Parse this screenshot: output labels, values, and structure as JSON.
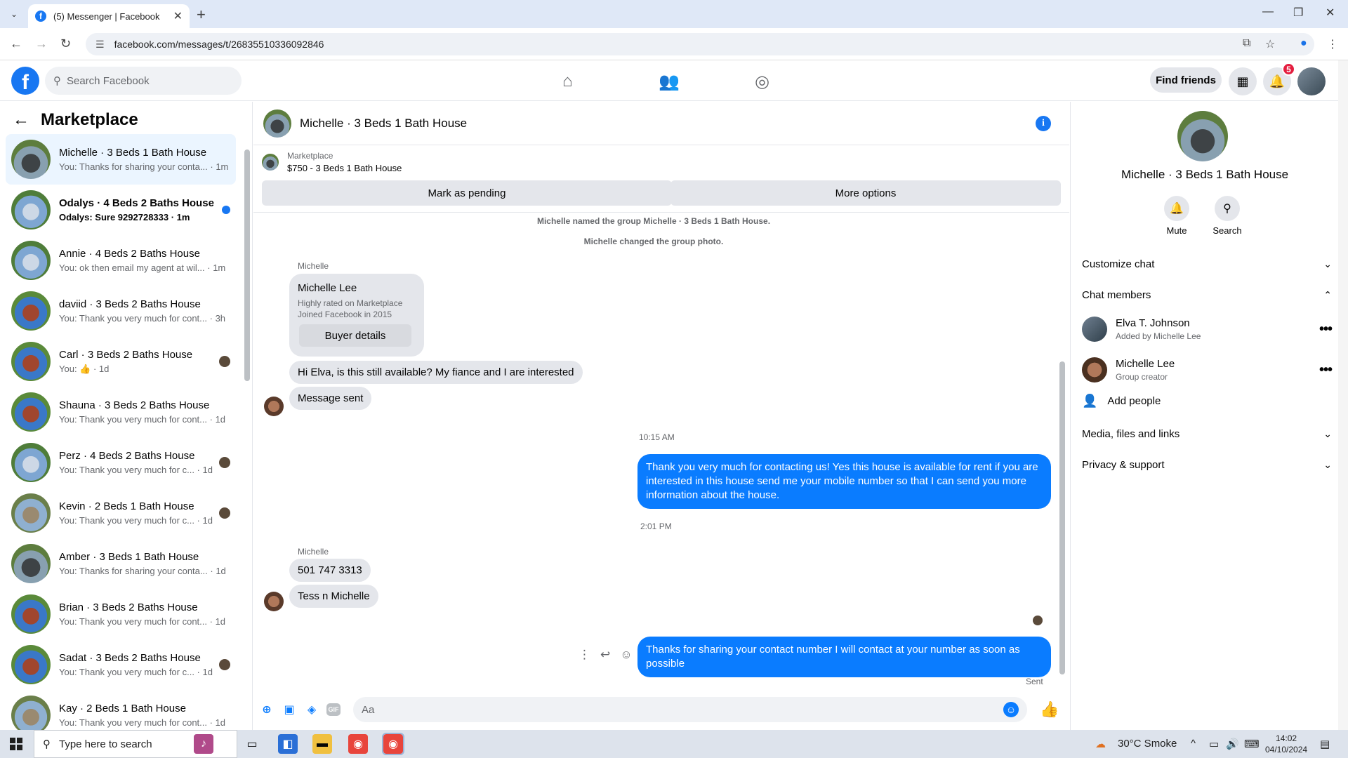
{
  "browser": {
    "tab_title": "(5) Messenger | Facebook",
    "url": "facebook.com/messages/t/26835510336092846"
  },
  "header": {
    "search_placeholder": "Search Facebook",
    "find_friends": "Find friends",
    "notification_count": "5"
  },
  "sidebar": {
    "title": "Marketplace",
    "conversations": [
      {
        "name": "Michelle · 3 Beds 1 Bath House",
        "preview": "You: Thanks for sharing your conta...",
        "time": "1m",
        "active": true,
        "unread": false,
        "house": "house1"
      },
      {
        "name": "Odalys · 4 Beds 2 Baths House",
        "preview": "Odalys: Sure 9292728333 · 1m",
        "time": "",
        "active": false,
        "unread": true,
        "house": "house2"
      },
      {
        "name": "Annie · 4 Beds 2 Baths House",
        "preview": "You: ok then email my agent at wil...",
        "time": "1m",
        "active": false,
        "unread": false,
        "house": "house2"
      },
      {
        "name": "daviid · 3 Beds 2 Baths House",
        "preview": "You: Thank you very much for cont...",
        "time": "3h",
        "active": false,
        "unread": false,
        "house": "house3"
      },
      {
        "name": "Carl · 3 Beds 2 Baths House",
        "preview": "You: 👍 · 1d",
        "time": "",
        "active": false,
        "unread": false,
        "house": "house3"
      },
      {
        "name": "Shauna · 3 Beds 2 Baths House",
        "preview": "You: Thank you very much for cont...",
        "time": "1d",
        "active": false,
        "unread": false,
        "house": "house3"
      },
      {
        "name": "Perz · 4 Beds 2 Baths House",
        "preview": "You: Thank you very much for c...",
        "time": "1d",
        "active": false,
        "unread": false,
        "house": "house2"
      },
      {
        "name": "Kevin · 2 Beds 1 Bath House",
        "preview": "You: Thank you very much for c...",
        "time": "1d",
        "active": false,
        "unread": false,
        "house": "house4"
      },
      {
        "name": "Amber · 3 Beds 1 Bath House",
        "preview": "You: Thanks for sharing your conta...",
        "time": "1d",
        "active": false,
        "unread": false,
        "house": "house1"
      },
      {
        "name": "Brian · 3 Beds 2 Baths House",
        "preview": "You: Thank you very much for cont...",
        "time": "1d",
        "active": false,
        "unread": false,
        "house": "house3"
      },
      {
        "name": "Sadat · 3 Beds 2 Baths House",
        "preview": "You: Thank you very much for c...",
        "time": "1d",
        "active": false,
        "unread": false,
        "house": "house3"
      },
      {
        "name": "Kay · 2 Beds 1 Bath House",
        "preview": "You: Thank you very much for cont...",
        "time": "1d",
        "active": false,
        "unread": false,
        "house": "house4"
      }
    ]
  },
  "chat": {
    "title": "Michelle · 3 Beds 1 Bath House",
    "listing_label": "Marketplace",
    "listing_price": "$750 - 3 Beds 1 Bath House",
    "mark_pending": "Mark as pending",
    "more_options": "More options",
    "system_1": "Michelle named the group Michelle · 3 Beds 1 Bath House.",
    "system_2": "Michelle changed the group photo.",
    "sender_1": "Michelle",
    "card_name": "Michelle Lee",
    "card_line1": "Highly rated on Marketplace",
    "card_line2": "Joined Facebook in 2015",
    "buyer_details": "Buyer details",
    "msg_in_1": "Hi Elva, is this still available? My fiance and I are interested",
    "msg_in_2": "Message sent",
    "time_1": "10:15 AM",
    "msg_out_1": "Thank you very much for contacting us! Yes this house is available for rent if you are interested in this house send me your mobile number so that I can send you more information about the house.",
    "time_2": "2:01 PM",
    "sender_2": "Michelle",
    "msg_in_3": "501 747 3313",
    "msg_in_4": "Tess n Michelle",
    "msg_out_2": "Thanks for sharing your contact number I will contact at your number as soon as possible",
    "sent_status": "Sent",
    "composer_placeholder": "Aa"
  },
  "details": {
    "name": "Michelle · 3 Beds 1 Bath House",
    "mute": "Mute",
    "search": "Search",
    "customize": "Customize chat",
    "members_heading": "Chat members",
    "members": [
      {
        "name": "Elva T. Johnson",
        "sub": "Added by Michelle Lee"
      },
      {
        "name": "Michelle Lee",
        "sub": "Group creator"
      }
    ],
    "add_people": "Add people",
    "media": "Media, files and links",
    "privacy": "Privacy & support"
  },
  "taskbar": {
    "search_placeholder": "Type here to search",
    "weather": "30°C  Smoke",
    "time": "14:02",
    "date": "04/10/2024"
  }
}
